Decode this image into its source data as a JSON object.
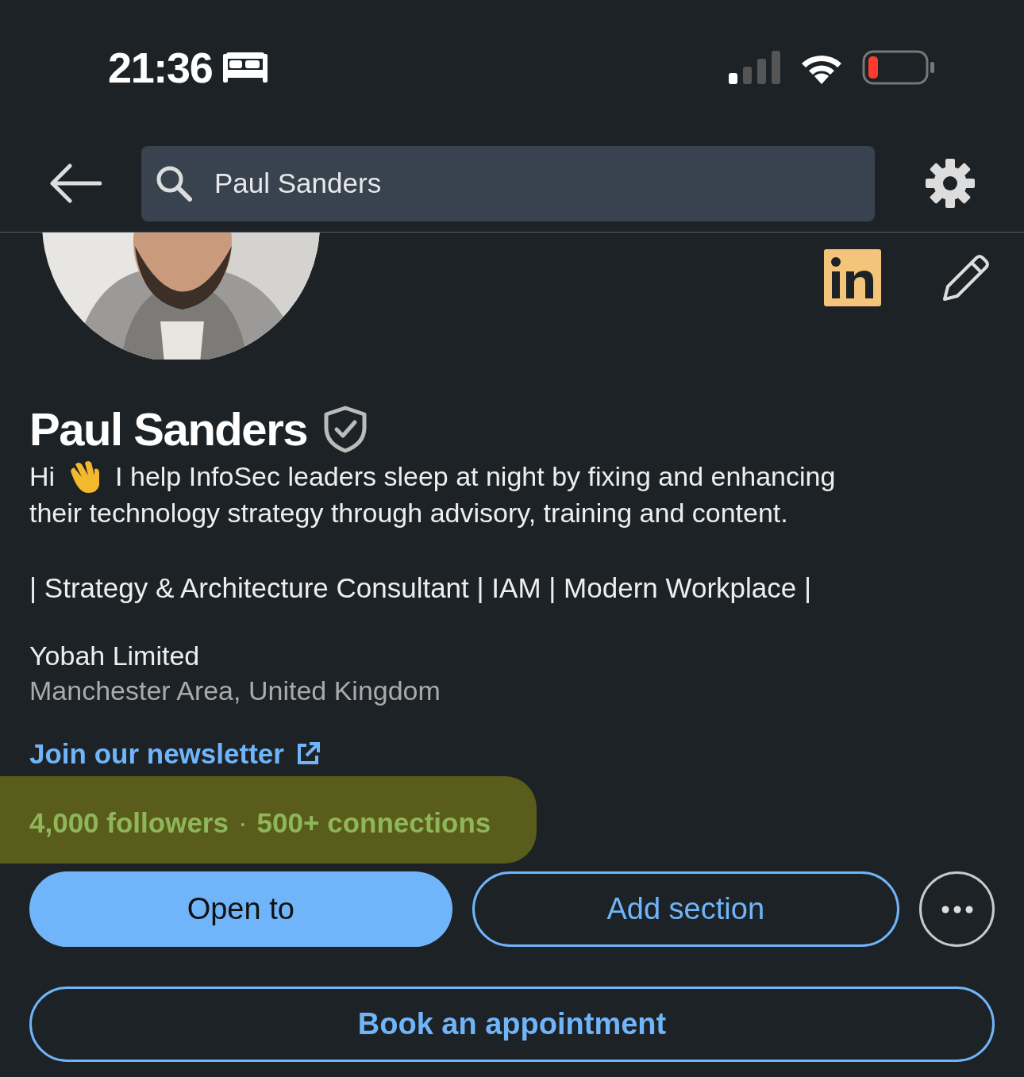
{
  "status_bar": {
    "time": "21:36"
  },
  "search": {
    "value": "Paul Sanders"
  },
  "profile": {
    "name": "Paul Sanders",
    "greeting": "Hi",
    "headline_lines": [
      "I help InfoSec leaders sleep at night by fixing and enhancing",
      "their technology strategy through advisory, training and content."
    ],
    "tagline": "| Strategy & Architecture Consultant | IAM | Modern Workplace |",
    "company": "Yobah Limited",
    "location": "Manchester Area, United Kingdom",
    "link": "Join our newsletter",
    "followers": "4,000 followers",
    "separator": "·",
    "connections": "500+ connections"
  },
  "buttons": [
    {
      "kind": "primary",
      "label": "Open to"
    },
    {
      "kind": "outline",
      "label": "Add section"
    },
    {
      "kind": "more"
    }
  ],
  "wide_button": {
    "label": "Book an appointment"
  }
}
